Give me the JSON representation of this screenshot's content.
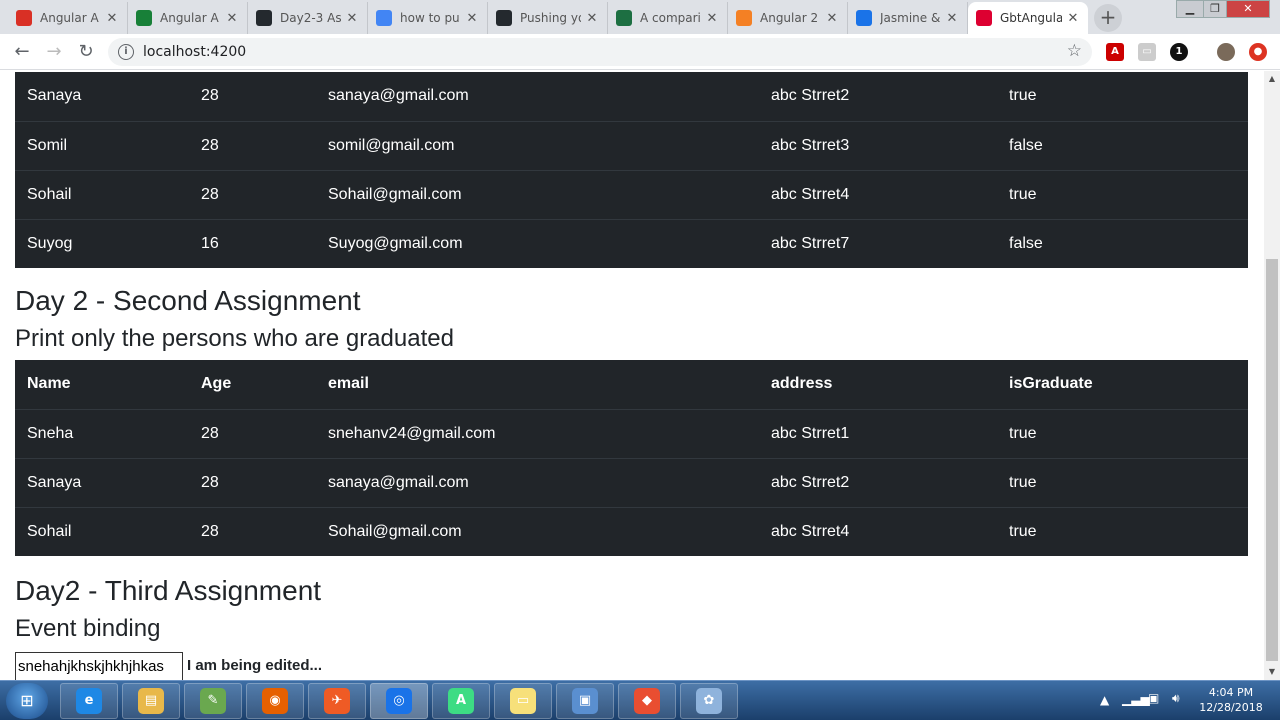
{
  "browser": {
    "tabs": [
      {
        "title": "Angular A",
        "icon": "gmail-icon",
        "color": "#d93025"
      },
      {
        "title": "Angular A",
        "icon": "sheets-icon",
        "color": "#188038"
      },
      {
        "title": "Day2-3 As",
        "icon": "github-icon",
        "color": "#24292e"
      },
      {
        "title": "how to pu",
        "icon": "google-icon",
        "color": "#4285f4"
      },
      {
        "title": "Pushing yo",
        "icon": "github-icon",
        "color": "#24292e"
      },
      {
        "title": "A compari",
        "icon": "excel-icon",
        "color": "#1d6f42"
      },
      {
        "title": "Angular 2",
        "icon": "stackoverflow-icon",
        "color": "#f48024"
      },
      {
        "title": "Jasmine &",
        "icon": "jasmine-icon",
        "color": "#1a73e8"
      },
      {
        "title": "GbtAngula",
        "icon": "angular-icon",
        "color": "#dd0031"
      }
    ],
    "url": "localhost:4200"
  },
  "page": {
    "table_top": {
      "rows": [
        [
          "Sanaya",
          "28",
          "sanaya@gmail.com",
          "abc Strret2",
          "true"
        ],
        [
          "Somil",
          "28",
          "somil@gmail.com",
          "abc Strret3",
          "false"
        ],
        [
          "Sohail",
          "28",
          "Sohail@gmail.com",
          "abc Strret4",
          "true"
        ],
        [
          "Suyog",
          "16",
          "Suyog@gmail.com",
          "abc Strret7",
          "false"
        ]
      ]
    },
    "second": {
      "heading": "Day 2 - Second Assignment",
      "subheading": "Print only the persons who are graduated",
      "columns": [
        "Name",
        "Age",
        "email",
        "address",
        "isGraduate"
      ],
      "rows": [
        [
          "Sneha",
          "28",
          "snehanv24@gmail.com",
          "abc Strret1",
          "true"
        ],
        [
          "Sanaya",
          "28",
          "sanaya@gmail.com",
          "abc Strret2",
          "true"
        ],
        [
          "Sohail",
          "28",
          "Sohail@gmail.com",
          "abc Strret4",
          "true"
        ]
      ]
    },
    "third": {
      "heading": "Day2 - Third Assignment",
      "subheading": "Event binding",
      "input_value": "snehahjkhskjhkhjhkas",
      "status": "I am being edited..."
    }
  },
  "taskbar": {
    "apps": [
      {
        "icon": "internet-explorer-icon",
        "color": "#1e88e5",
        "glyph": "e"
      },
      {
        "icon": "file-explorer-icon",
        "color": "#e8b84a",
        "glyph": "▤"
      },
      {
        "icon": "notepad-plus-icon",
        "color": "#6aa84f",
        "glyph": "✎"
      },
      {
        "icon": "firefox-icon",
        "color": "#e66000",
        "glyph": "◉"
      },
      {
        "icon": "postman-icon",
        "color": "#ef5b25",
        "glyph": "✈"
      },
      {
        "icon": "chrome-icon",
        "color": "#1a73e8",
        "glyph": "◎"
      },
      {
        "icon": "android-studio-icon",
        "color": "#3ddc84",
        "glyph": "A"
      },
      {
        "icon": "sticky-notes-icon",
        "color": "#f7e07a",
        "glyph": "▭"
      },
      {
        "icon": "remote-desktop-icon",
        "color": "#5a8fd0",
        "glyph": "▣"
      },
      {
        "icon": "git-icon",
        "color": "#e94e31",
        "glyph": "◆"
      },
      {
        "icon": "paint-icon",
        "color": "#8fb3dc",
        "glyph": "✿"
      }
    ],
    "time": "4:04 PM",
    "date": "12/28/2018"
  }
}
